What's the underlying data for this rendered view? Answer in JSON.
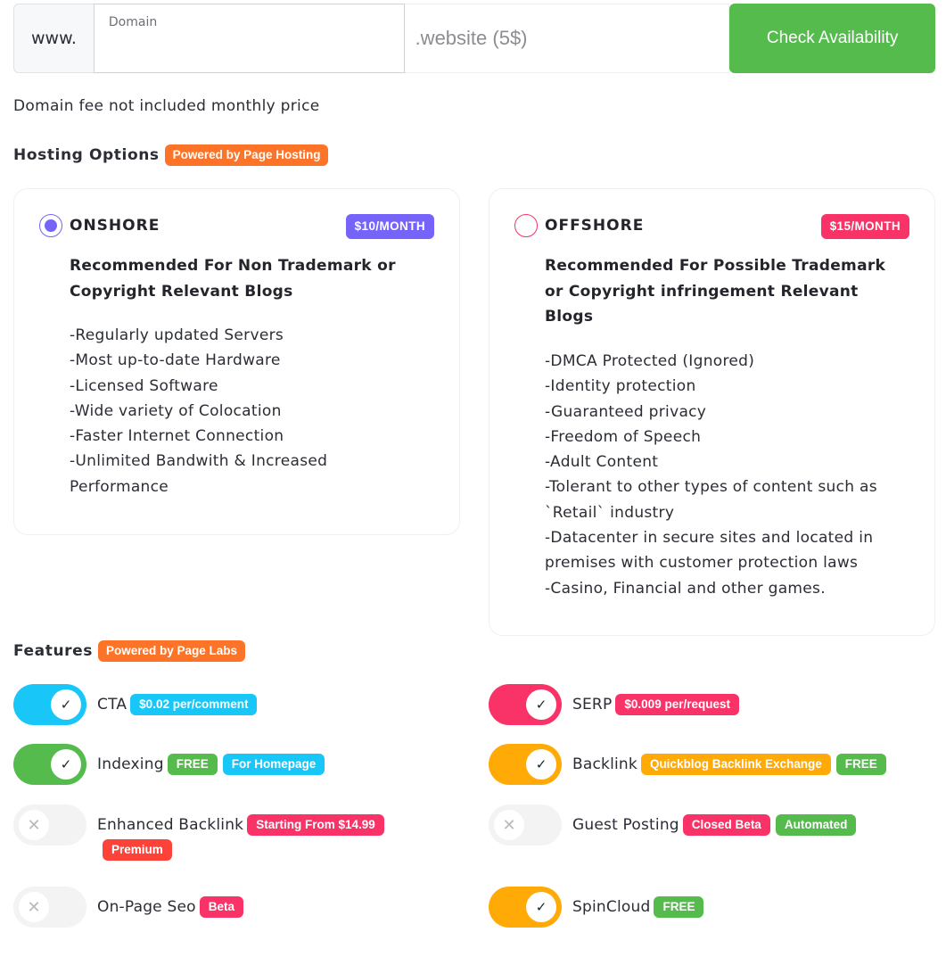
{
  "domain_search": {
    "prefix": "www.",
    "field_label": "Domain",
    "field_value": "",
    "tld": ".website (5$)",
    "button_label": "Check Availability"
  },
  "note": "Domain fee not included monthly price",
  "hosting": {
    "title": "Hosting Options",
    "powered_badge": "Powered by Page Hosting",
    "options": [
      {
        "name": "ONSHORE",
        "selected": true,
        "price": "$10/MONTH",
        "color": "#7664fa",
        "recommendation": "Recommended For Non Trademark or Copyright Relevant Blogs",
        "bullets": [
          "-Regularly updated Servers",
          "-Most up-to-date Hardware",
          "-Licensed Software",
          "-Wide variety of Colocation",
          "-Faster Internet Connection",
          "-Unlimited Bandwith & Increased Performance"
        ]
      },
      {
        "name": "OFFSHORE",
        "selected": false,
        "price": "$15/MONTH",
        "color": "#f93367",
        "recommendation": "Recommended For Possible Trademark or Copyright infringement Relevant Blogs",
        "bullets": [
          "-DMCA Protected (Ignored)",
          "-Identity protection",
          "-Guaranteed privacy",
          "-Freedom of Speech",
          "-Adult Content",
          "-Tolerant to other types of content such as `Retail` industry",
          "-Datacenter in secure sites and located in premises with customer protection laws",
          "-Casino, Financial and other games."
        ]
      }
    ]
  },
  "features": {
    "title": "Features",
    "powered_badge": "Powered by Page Labs",
    "items": [
      {
        "label": "CTA",
        "enabled": true,
        "color": "#18c6f7",
        "badges": [
          {
            "text": "$0.02 per/comment",
            "color": "#18c6f7"
          }
        ]
      },
      {
        "label": "SERP",
        "enabled": true,
        "color": "#f93367",
        "badges": [
          {
            "text": "$0.009 per/request",
            "color": "#f93367"
          }
        ]
      },
      {
        "label": "Indexing",
        "enabled": true,
        "color": "#55bb4d",
        "badges": [
          {
            "text": "FREE",
            "color": "#55bb4d"
          },
          {
            "text": "For Homepage",
            "color": "#18c6f7"
          }
        ]
      },
      {
        "label": "Backlink",
        "enabled": true,
        "color": "#ffaa06",
        "badges": [
          {
            "text": "Quickblog Backlink Exchange",
            "color": "#ffaa06"
          },
          {
            "text": "FREE",
            "color": "#55bb4d"
          }
        ]
      },
      {
        "label": "Enhanced Backlink",
        "enabled": false,
        "color": "#f3f3f4",
        "badges": [
          {
            "text": "Starting From $14.99",
            "color": "#f93367"
          },
          {
            "text": "Premium",
            "color": "#fd4339"
          }
        ]
      },
      {
        "label": "Guest Posting",
        "enabled": false,
        "color": "#f3f3f4",
        "badges": [
          {
            "text": "Closed Beta",
            "color": "#f93367"
          },
          {
            "text": "Automated",
            "color": "#55bb4d"
          }
        ]
      },
      {
        "label": "On-Page Seo",
        "enabled": false,
        "color": "#f3f3f4",
        "badges": [
          {
            "text": "Beta",
            "color": "#f93367"
          }
        ]
      },
      {
        "label": "SpinCloud",
        "enabled": true,
        "color": "#ffaa06",
        "badges": [
          {
            "text": "FREE",
            "color": "#55bb4d"
          }
        ]
      }
    ]
  },
  "icons": {
    "check": "✓",
    "cross": "✕"
  }
}
